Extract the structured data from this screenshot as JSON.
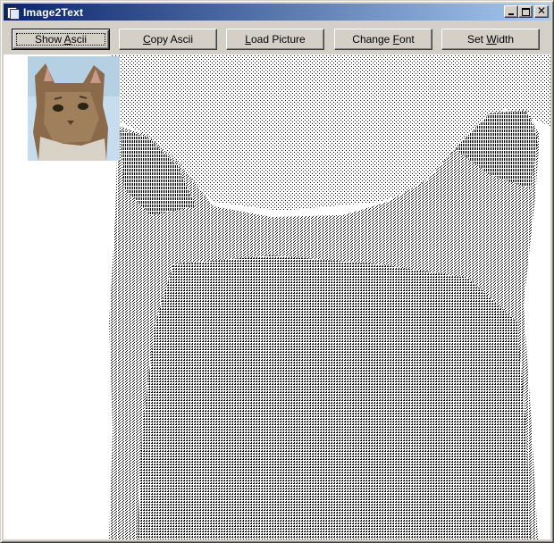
{
  "window": {
    "title": "Image2Text",
    "icon": "app-window-icon",
    "caption_buttons": [
      "minimize-icon",
      "maximize-icon",
      "close-icon"
    ]
  },
  "toolbar": {
    "buttons": [
      {
        "label": "Show Ascii",
        "mnemonic": "A"
      },
      {
        "label": "Copy Ascii",
        "mnemonic": "C"
      },
      {
        "label": "Load Picture",
        "mnemonic": "L"
      },
      {
        "label": "Change Font",
        "mnemonic": "F"
      },
      {
        "label": "Set Width",
        "mnemonic": "W"
      }
    ]
  },
  "preview": {
    "thumbnail": "cat-photo-thumbnail",
    "ascii_output": "ascii-art-cat-rendering"
  },
  "colors": {
    "titlebar_start": "#0a246a",
    "titlebar_end": "#a6caf0",
    "face": "#d4d0c8",
    "canvas_bg": "#ffffff",
    "ascii_ink": "#000000"
  }
}
